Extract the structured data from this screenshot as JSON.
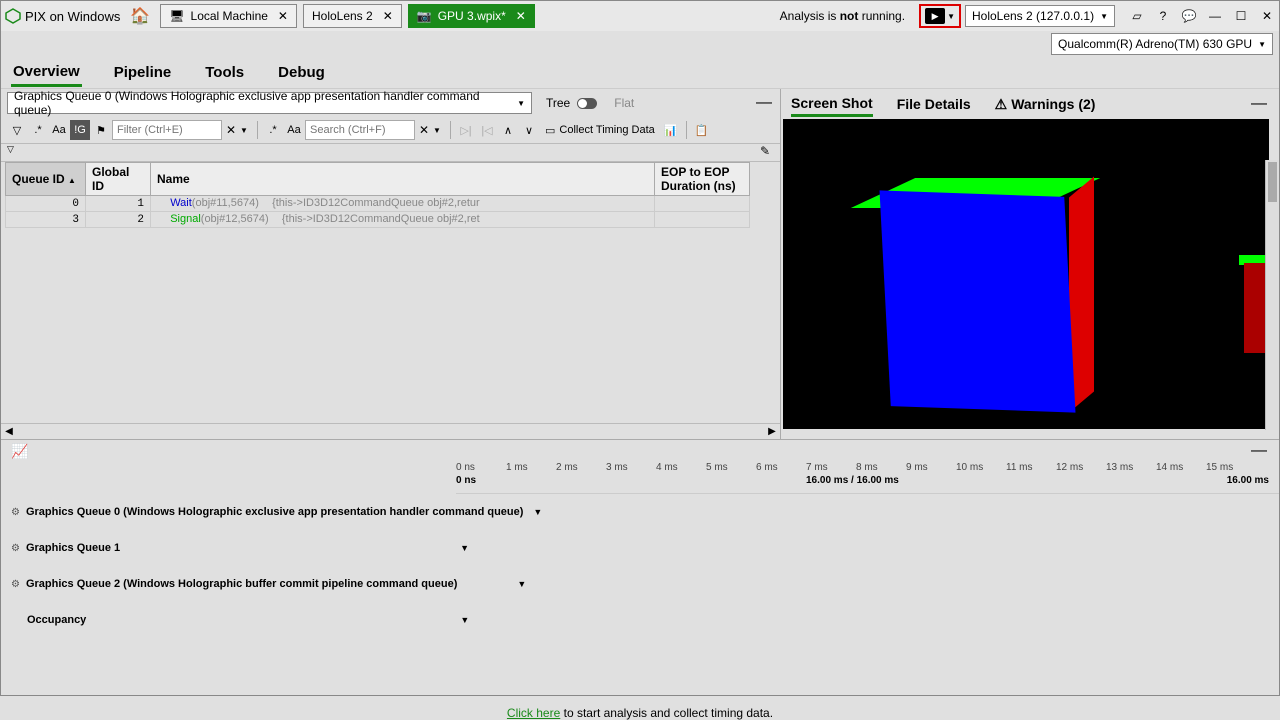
{
  "app": {
    "title": "PIX on Windows"
  },
  "tabs": [
    {
      "icon": "🖥",
      "label": "Local Machine"
    },
    {
      "icon": "",
      "label": "HoloLens 2"
    },
    {
      "icon": "📷",
      "label": "GPU 3.wpix*"
    }
  ],
  "status": {
    "prefix": "Analysis is ",
    "bold": "not",
    "suffix": " running."
  },
  "targets": {
    "device": "HoloLens 2 (127.0.0.1)",
    "gpu": "Qualcomm(R) Adreno(TM) 630 GPU"
  },
  "menu": [
    "Overview",
    "Pipeline",
    "Tools",
    "Debug"
  ],
  "queue_combo": "Graphics Queue 0 (Windows Holographic exclusive app presentation handler command queue)",
  "tree_label": "Tree",
  "flat_label": "Flat",
  "filter1_placeholder": "Filter (Ctrl+E)",
  "filter2_placeholder": "Search (Ctrl+F)",
  "collect_label": "Collect Timing Data",
  "table": {
    "cols": [
      "Queue ID",
      "Global ID",
      "Name",
      "EOP to EOP Duration (ns)"
    ],
    "rows": [
      {
        "qid": "0",
        "gid": "1",
        "fn": "Wait",
        "args1": "(obj#11,5674)",
        "args2": "{this->ID3D12CommandQueue obj#2,retur"
      },
      {
        "qid": "3",
        "gid": "2",
        "fn": "Signal",
        "args1": "(obj#12,5674)",
        "args2": "{this->ID3D12CommandQueue obj#2,ret"
      }
    ]
  },
  "right_tabs": {
    "a": "Screen Shot",
    "b": "File Details",
    "c": "Warnings (2)"
  },
  "ruler": {
    "ticks": [
      "0 ns",
      "1 ms",
      "2 ms",
      "3 ms",
      "4 ms",
      "5 ms",
      "6 ms",
      "7 ms",
      "8 ms",
      "9 ms",
      "10 ms",
      "11 ms",
      "12 ms",
      "13 ms",
      "14 ms",
      "15 ms"
    ],
    "lower0": "0 ns",
    "lower7": "16.00 ms / 16.00 ms",
    "lower15": "16.00 ms"
  },
  "timeline_rows": [
    "Graphics Queue 0 (Windows Holographic exclusive app presentation handler command queue)",
    "Graphics Queue 1",
    "Graphics Queue 2 (Windows Holographic buffer commit pipeline command queue)",
    "Occupancy"
  ],
  "tl_link": "Click here",
  "tl_msg": " to start analysis and collect timing data."
}
